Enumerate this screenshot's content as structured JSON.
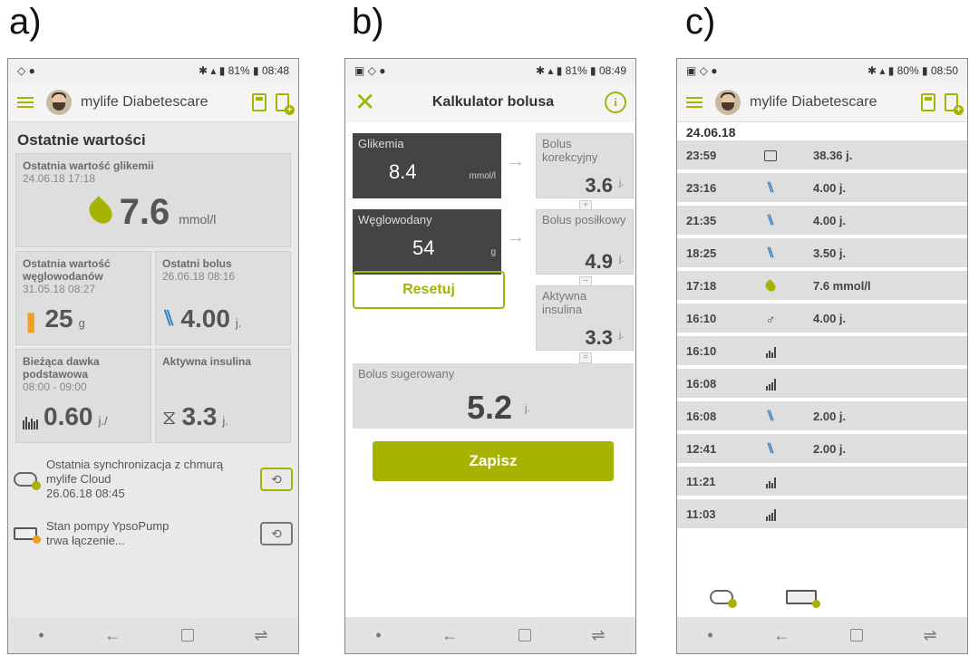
{
  "labels": {
    "a": "a)",
    "b": "b)",
    "c": "c)"
  },
  "panel_a": {
    "status": {
      "battery": "81%",
      "time": "08:48"
    },
    "app_title": "mylife Diabetescare",
    "section_title": "Ostatnie wartości",
    "last_glucose": {
      "label": "Ostatnia wartość glikemii",
      "date": "24.06.18  17:18",
      "value": "7.6",
      "unit": "mmol/l"
    },
    "last_carbs": {
      "label": "Ostatnia wartość węglowodanów",
      "date": "31.05.18  08:27",
      "value": "25",
      "unit": "g"
    },
    "last_bolus": {
      "label": "Ostatni bolus",
      "date": "26.06.18  08:16",
      "value": "4.00",
      "unit": "j."
    },
    "basal": {
      "label": "Bieżąca dawka podstawowa",
      "range": "08:00 - 09:00",
      "value": "0.60",
      "unit": "j./"
    },
    "active_insulin": {
      "label": "Aktywna insulina",
      "value": "3.3",
      "unit": "j."
    },
    "cloud_sync": {
      "line1": "Ostatnia synchronizacja z chmurą",
      "line2": "mylife Cloud",
      "line3": "26.06.18  08:45"
    },
    "pump_status": {
      "line1": "Stan pompy YpsoPump",
      "line2": "trwa łączenie..."
    }
  },
  "panel_b": {
    "status": {
      "battery": "81%",
      "time": "08:49"
    },
    "title": "Kalkulator bolusa",
    "glucose": {
      "label": "Glikemia",
      "value": "8.4",
      "unit": "mmol/l"
    },
    "carbs": {
      "label": "Węglowodany",
      "value": "54",
      "unit": "g"
    },
    "correction": {
      "label": "Bolus korekcyjny",
      "value": "3.6",
      "unit": "j."
    },
    "meal": {
      "label": "Bolus posiłkowy",
      "value": "4.9",
      "unit": "j."
    },
    "active": {
      "label": "Aktywna insulina",
      "value": "3.3",
      "unit": "j."
    },
    "ops": {
      "plus": "+",
      "minus": "−",
      "equals": "="
    },
    "reset_label": "Resetuj",
    "suggested": {
      "label": "Bolus sugerowany",
      "value": "5.2",
      "unit": "j."
    },
    "save_label": "Zapisz"
  },
  "panel_c": {
    "status": {
      "battery": "80%",
      "time": "08:50"
    },
    "app_title": "mylife Diabetescare",
    "date": "24.06.18",
    "rows": [
      {
        "time": "23:59",
        "icon": "daily-total-icon",
        "value": "38.36 j."
      },
      {
        "time": "23:16",
        "icon": "fork-knife-icon",
        "value": "4.00 j."
      },
      {
        "time": "21:35",
        "icon": "fork-knife-icon",
        "value": "4.00 j."
      },
      {
        "time": "18:25",
        "icon": "fork-knife-icon",
        "value": "3.50 j."
      },
      {
        "time": "17:18",
        "icon": "blood-drop-icon",
        "value": "7.6 mmol/l"
      },
      {
        "time": "16:10",
        "icon": "correction-bolus-icon",
        "value": "4.00 j."
      },
      {
        "time": "16:10",
        "icon": "basal-start-icon",
        "value": ""
      },
      {
        "time": "16:08",
        "icon": "basal-stop-icon",
        "value": ""
      },
      {
        "time": "16:08",
        "icon": "fork-knife-icon",
        "value": "2.00 j."
      },
      {
        "time": "12:41",
        "icon": "fork-knife-icon",
        "value": "2.00 j."
      },
      {
        "time": "11:21",
        "icon": "basal-start-icon",
        "value": ""
      },
      {
        "time": "11:03",
        "icon": "basal-stop-icon",
        "value": ""
      }
    ]
  },
  "colors": {
    "accent": "#a6b300",
    "dark_card": "#444444",
    "card": "#dedede"
  }
}
